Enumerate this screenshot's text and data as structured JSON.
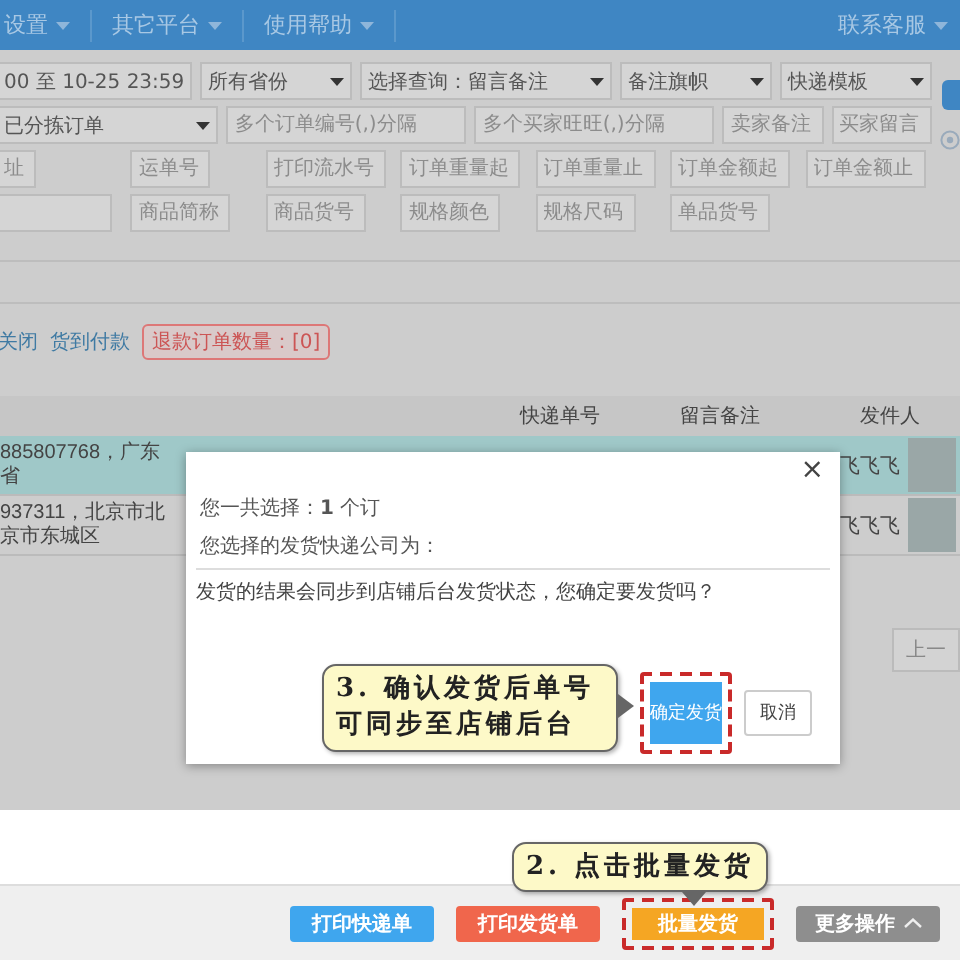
{
  "top_menu": {
    "items": [
      {
        "label": "设置"
      },
      {
        "label": "其它平台"
      },
      {
        "label": "使用帮助"
      }
    ],
    "contact": "联系客服"
  },
  "filters": {
    "rows": [
      [
        {
          "kind": "date",
          "value": "00 至 10-25 23:59"
        },
        {
          "kind": "select",
          "value": "所有省份"
        },
        {
          "kind": "select",
          "value": "选择查询：留言备注"
        },
        {
          "kind": "select",
          "value": "备注旗帜"
        },
        {
          "kind": "select",
          "value": "快递模板"
        }
      ],
      [
        {
          "kind": "select",
          "value": "已分拣订单"
        },
        {
          "kind": "input",
          "placeholder": "多个订单编号(,)分隔"
        },
        {
          "kind": "input",
          "placeholder": "多个买家旺旺(,)分隔"
        },
        {
          "kind": "input",
          "placeholder": "卖家备注"
        },
        {
          "kind": "input",
          "placeholder": "买家留言"
        }
      ],
      [
        {
          "kind": "input",
          "placeholder": "址"
        },
        {
          "kind": "input",
          "placeholder": "运单号"
        },
        {
          "kind": "input",
          "placeholder": "打印流水号"
        },
        {
          "kind": "input",
          "placeholder": "订单重量起"
        },
        {
          "kind": "input",
          "placeholder": "订单重量止"
        },
        {
          "kind": "input",
          "placeholder": "订单金额起"
        },
        {
          "kind": "input",
          "placeholder": "订单金额止"
        }
      ],
      [
        {
          "kind": "input"
        },
        {
          "kind": "input",
          "placeholder": "商品简称"
        },
        {
          "kind": "input",
          "placeholder": "商品货号"
        },
        {
          "kind": "input",
          "placeholder": "规格颜色"
        },
        {
          "kind": "input",
          "placeholder": "规格尺码"
        },
        {
          "kind": "input",
          "placeholder": "单品货号"
        }
      ]
    ]
  },
  "quick_filters": [
    {
      "label": "关闭"
    },
    {
      "label": "货到付款"
    }
  ],
  "refund_badge": "退款订单数量：[0]",
  "table": {
    "columns": [
      "快递单号",
      "留言备注",
      "发件人"
    ],
    "rows": [
      {
        "address": "885807768，广东省",
        "sender": "飞飞飞",
        "selected": true
      },
      {
        "address": "937311，北京市北京市东城区",
        "sender": "飞飞飞",
        "selected": false
      }
    ]
  },
  "pager": {
    "label": "上一"
  },
  "dialog": {
    "close": "×",
    "summary": "您一共选择：**1** 个订",
    "company": "您选择的发货快递公司为：",
    "message": "发货的结果会同步到店铺后台发货状态，您确定要发货吗？",
    "buttons": [
      {
        "label": "确定发货",
        "kind": "primary",
        "highlighted": true
      },
      {
        "label": "取消",
        "kind": "default",
        "highlighted": false
      }
    ],
    "callout": "3. 确认发货后单号可同步至店铺后台"
  },
  "action_bar": {
    "buttons": [
      {
        "label": "打印快递单",
        "kind": "blue",
        "highlighted": false,
        "has_menu": false
      },
      {
        "label": "打印发货单",
        "kind": "red",
        "highlighted": false,
        "has_menu": false
      },
      {
        "label": "批量发货",
        "kind": "orange",
        "highlighted": true,
        "has_menu": false
      },
      {
        "label": "更多操作",
        "kind": "gray",
        "highlighted": false,
        "has_menu": true
      }
    ],
    "callout": "2. 点击批量发货"
  }
}
